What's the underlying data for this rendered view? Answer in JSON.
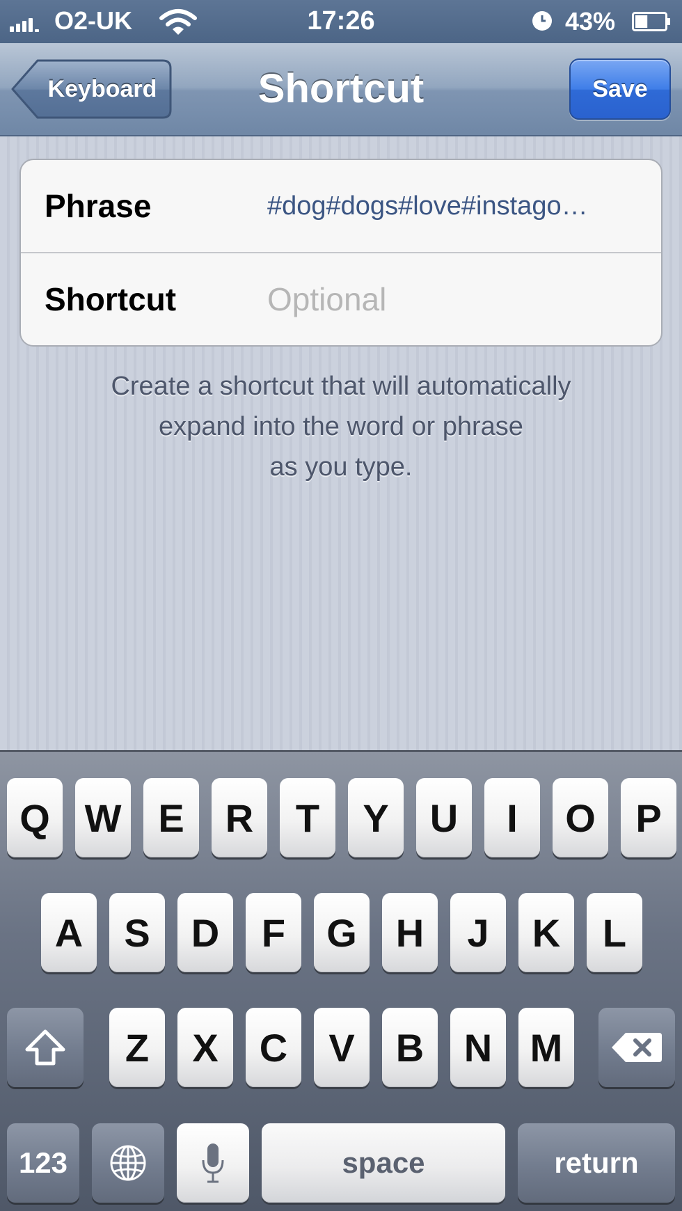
{
  "status_bar": {
    "carrier": "O2-UK",
    "time": "17:26",
    "battery_percent": "43%",
    "battery_level": 0.43,
    "icons": [
      "signal-bars-icon",
      "wifi-icon",
      "alarm-clock-icon",
      "battery-icon"
    ]
  },
  "navbar": {
    "back_label": "Keyboard",
    "title": "Shortcut",
    "save_label": "Save"
  },
  "form": {
    "phrase_label": "Phrase",
    "phrase_value": "#dog#dogs#love#instago…",
    "shortcut_label": "Shortcut",
    "shortcut_value": "",
    "shortcut_placeholder": "Optional"
  },
  "footnote": {
    "lines": [
      "Create a shortcut that will automatically",
      "expand into the word or phrase",
      "as you type."
    ]
  },
  "keyboard": {
    "row1": [
      "Q",
      "W",
      "E",
      "R",
      "T",
      "Y",
      "U",
      "I",
      "O",
      "P"
    ],
    "row2": [
      "A",
      "S",
      "D",
      "F",
      "G",
      "H",
      "J",
      "K",
      "L"
    ],
    "row3": [
      "Z",
      "X",
      "C",
      "V",
      "B",
      "N",
      "M"
    ],
    "numbers_label": "123",
    "space_label": "space",
    "return_label": "return",
    "special_icons": [
      "shift-icon",
      "backspace-icon",
      "globe-icon",
      "microphone-icon"
    ]
  },
  "colors": {
    "nav_accent": "#2f6ad6",
    "phrase_value_color": "#3b5583",
    "placeholder_color": "#b6b6b6"
  }
}
